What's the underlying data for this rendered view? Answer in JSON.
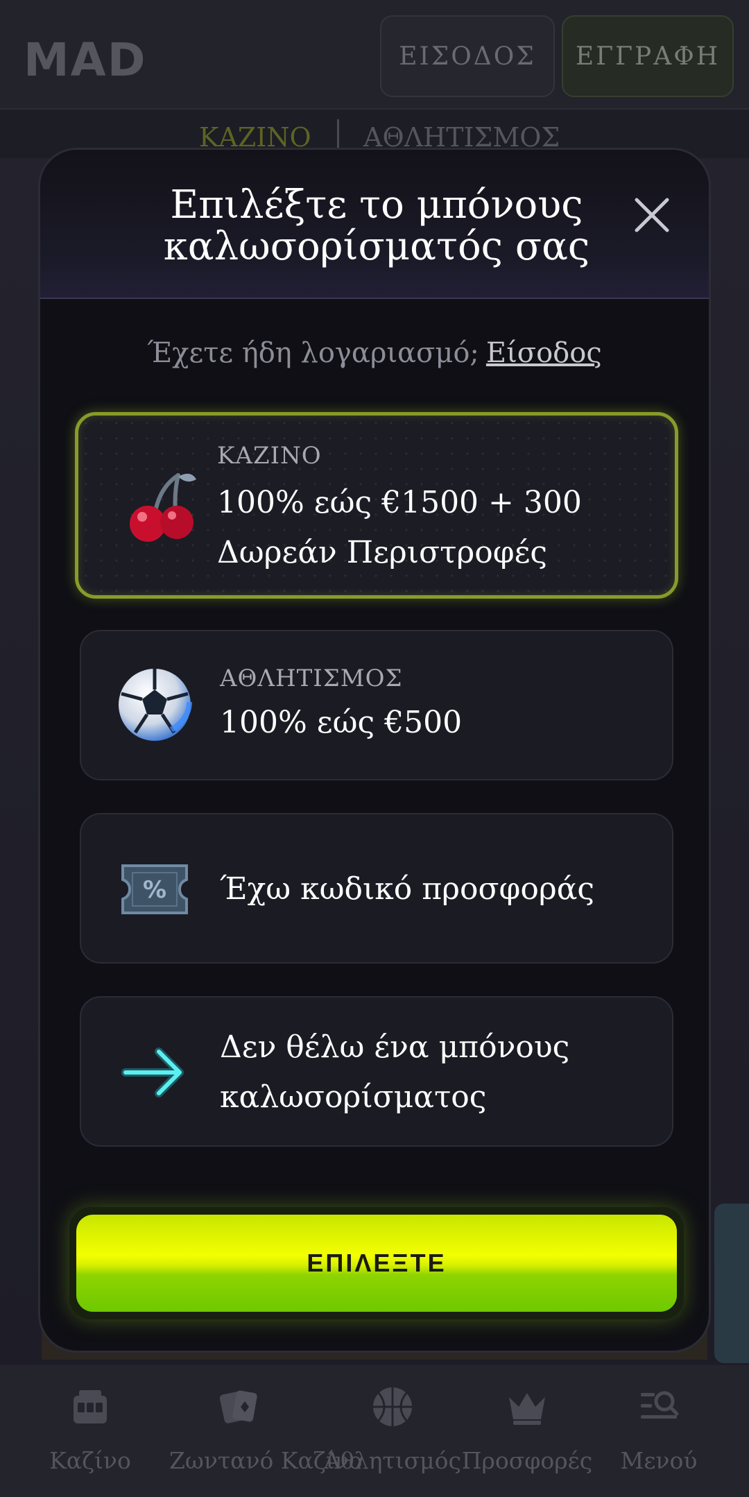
{
  "header": {
    "logo": "MAD",
    "login_label": "ΕΙΣΟΔΟΣ",
    "register_label": "ΕΓΓΡΑΦΗ"
  },
  "top_tabs": [
    {
      "label": "ΚΑΖΙΝΟ"
    },
    {
      "label": "ΑΘΛΗΤΙΣΜΟΣ"
    }
  ],
  "modal": {
    "title_line1": "Επιλέξτε το μπόνους",
    "title_line2": "καλωσορίσματός σας",
    "have_account_text": "Έχετε ήδη λογαριασμό;",
    "login_link": "Είσοδος",
    "options": [
      {
        "label": "ΚΑΖΙΝΟ",
        "line1": "100% εώς €1500 + 300",
        "line2": "Δωρεάν Περιστροφές",
        "icon": "cherry-icon",
        "selected": true
      },
      {
        "label": "ΑΘΛΗΤΙΣΜΟΣ",
        "line1": "100% εώς €500",
        "icon": "soccer-ball-icon",
        "selected": false
      },
      {
        "text": "Έχω κωδικό προσφοράς",
        "icon": "promo-ticket-icon",
        "selected": false
      },
      {
        "line1": "Δεν θέλω ένα μπόνους",
        "line2": "καλωσορίσματος",
        "icon": "arrow-right-icon",
        "selected": false
      }
    ],
    "cta_label": "ΕΠΙΛΕΞΤΕ"
  },
  "bottom_nav": [
    {
      "label": "Καζίνο",
      "icon": "slot-machine-icon"
    },
    {
      "label": "Ζωντανό Καζίνο",
      "icon": "cards-icon"
    },
    {
      "label": "Αθλητισμός",
      "icon": "basketball-icon"
    },
    {
      "label": "Προσφορές",
      "icon": "crown-icon"
    },
    {
      "label": "Μενού",
      "icon": "menu-search-icon"
    }
  ],
  "colors": {
    "accent": "#f3ff00",
    "selected_border": "#8a9a2a",
    "modal_bg": "#0f0f15",
    "card_bg": "#1b1b24"
  }
}
